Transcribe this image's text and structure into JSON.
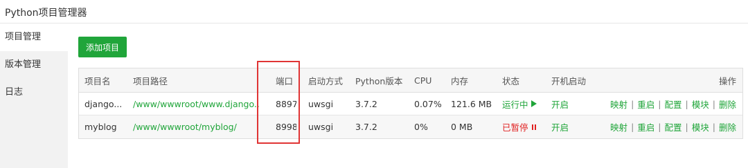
{
  "window": {
    "title": "Python项目管理器"
  },
  "sidebar": {
    "items": [
      {
        "label": "项目管理",
        "active": true
      },
      {
        "label": "版本管理",
        "active": false
      },
      {
        "label": "日志",
        "active": false
      }
    ]
  },
  "toolbar": {
    "add_label": "添加项目"
  },
  "table": {
    "headers": {
      "name": "项目名",
      "path": "项目路径",
      "port": "端口",
      "start": "启动方式",
      "python": "Python版本",
      "cpu": "CPU",
      "mem": "内存",
      "status": "状态",
      "boot": "开机启动",
      "ops": "操作"
    },
    "rows": [
      {
        "name": "django...",
        "path": "/www/wwwroot/www.django...",
        "port": "8897",
        "start": "uwsgi",
        "python": "3.7.2",
        "cpu": "0.07%",
        "mem": "121.6 MB",
        "status": "运行中",
        "status_icon": "play-icon",
        "boot": "开启"
      },
      {
        "name": "myblog",
        "path": "/www/wwwroot/myblog/",
        "port": "8998",
        "start": "uwsgi",
        "python": "3.7.2",
        "cpu": "0%",
        "mem": "0 MB",
        "status": "已暂停",
        "status_icon": "pause-icon",
        "boot": "开启"
      }
    ],
    "actions": [
      "映射",
      "重启",
      "配置",
      "模块",
      "删除"
    ],
    "separator": "|"
  },
  "colors": {
    "accent": "#20a53a",
    "stopped": "#e02020",
    "highlight": "#e03434"
  }
}
